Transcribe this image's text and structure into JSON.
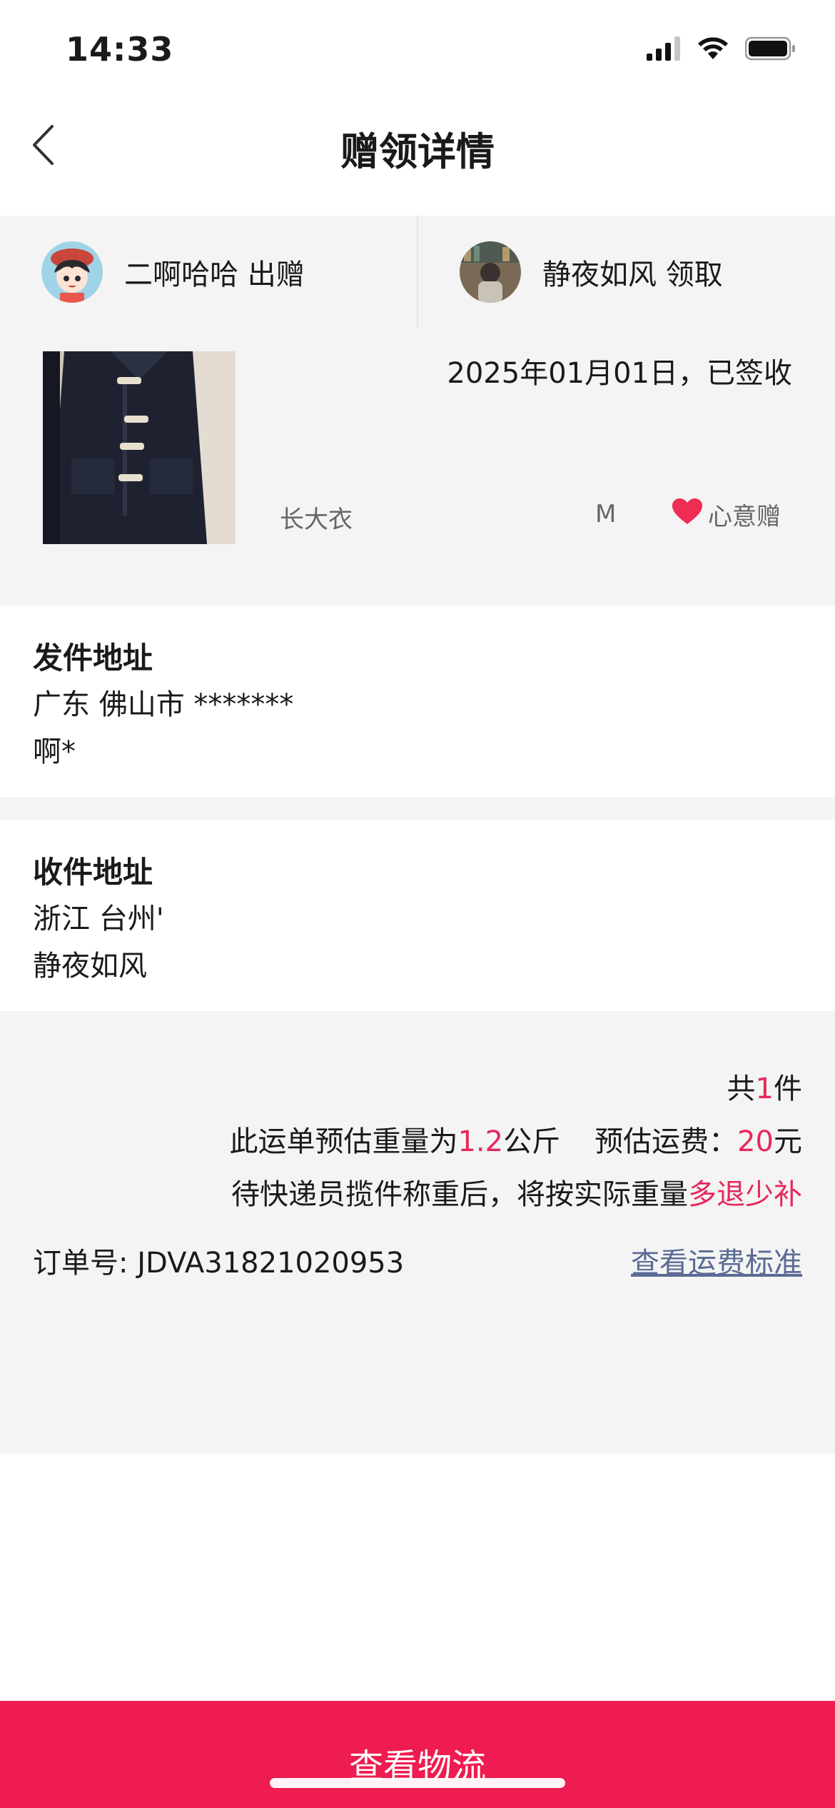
{
  "status_bar": {
    "time": "14:33",
    "icons": [
      "cellular-signal-icon",
      "wifi-icon",
      "battery-icon"
    ]
  },
  "nav": {
    "title": "赠领详情",
    "back_icon": "chevron-left-icon"
  },
  "parties": {
    "giver": {
      "label": "二啊哈哈 出赠"
    },
    "receiver": {
      "label": "静夜如风 领取"
    }
  },
  "product": {
    "status_date": "2025年01月01日，已签收",
    "name": "长大衣",
    "size": "M",
    "tag": "心意赠",
    "tag_icon": "heart-icon"
  },
  "sender_address": {
    "title": "发件地址",
    "line1": "广东 佛山市 *******",
    "line2": "啊*"
  },
  "receiver_address": {
    "title": "收件地址",
    "line1": "浙江 台州'",
    "line2": "静夜如风"
  },
  "shipping": {
    "count_prefix": "共",
    "count": "1",
    "count_suffix": "件",
    "weight_prefix": "此运单预估重量为",
    "weight": "1.2",
    "weight_unit": "公斤",
    "fee_label": "预估运费：",
    "fee": "20",
    "fee_unit": "元",
    "note_prefix": "待快递员揽件称重后，将按实际重量",
    "note_highlight": "多退少补",
    "order_label": "订单号:",
    "order_number": "JDVA31821020953",
    "fee_standard_link": "查看运费标准"
  },
  "bottom": {
    "button_label": "查看物流"
  },
  "colors": {
    "accent": "#ee1c50",
    "highlight": "#e6285a",
    "link": "#5b6b94",
    "section_bg": "#f4f4f4"
  }
}
